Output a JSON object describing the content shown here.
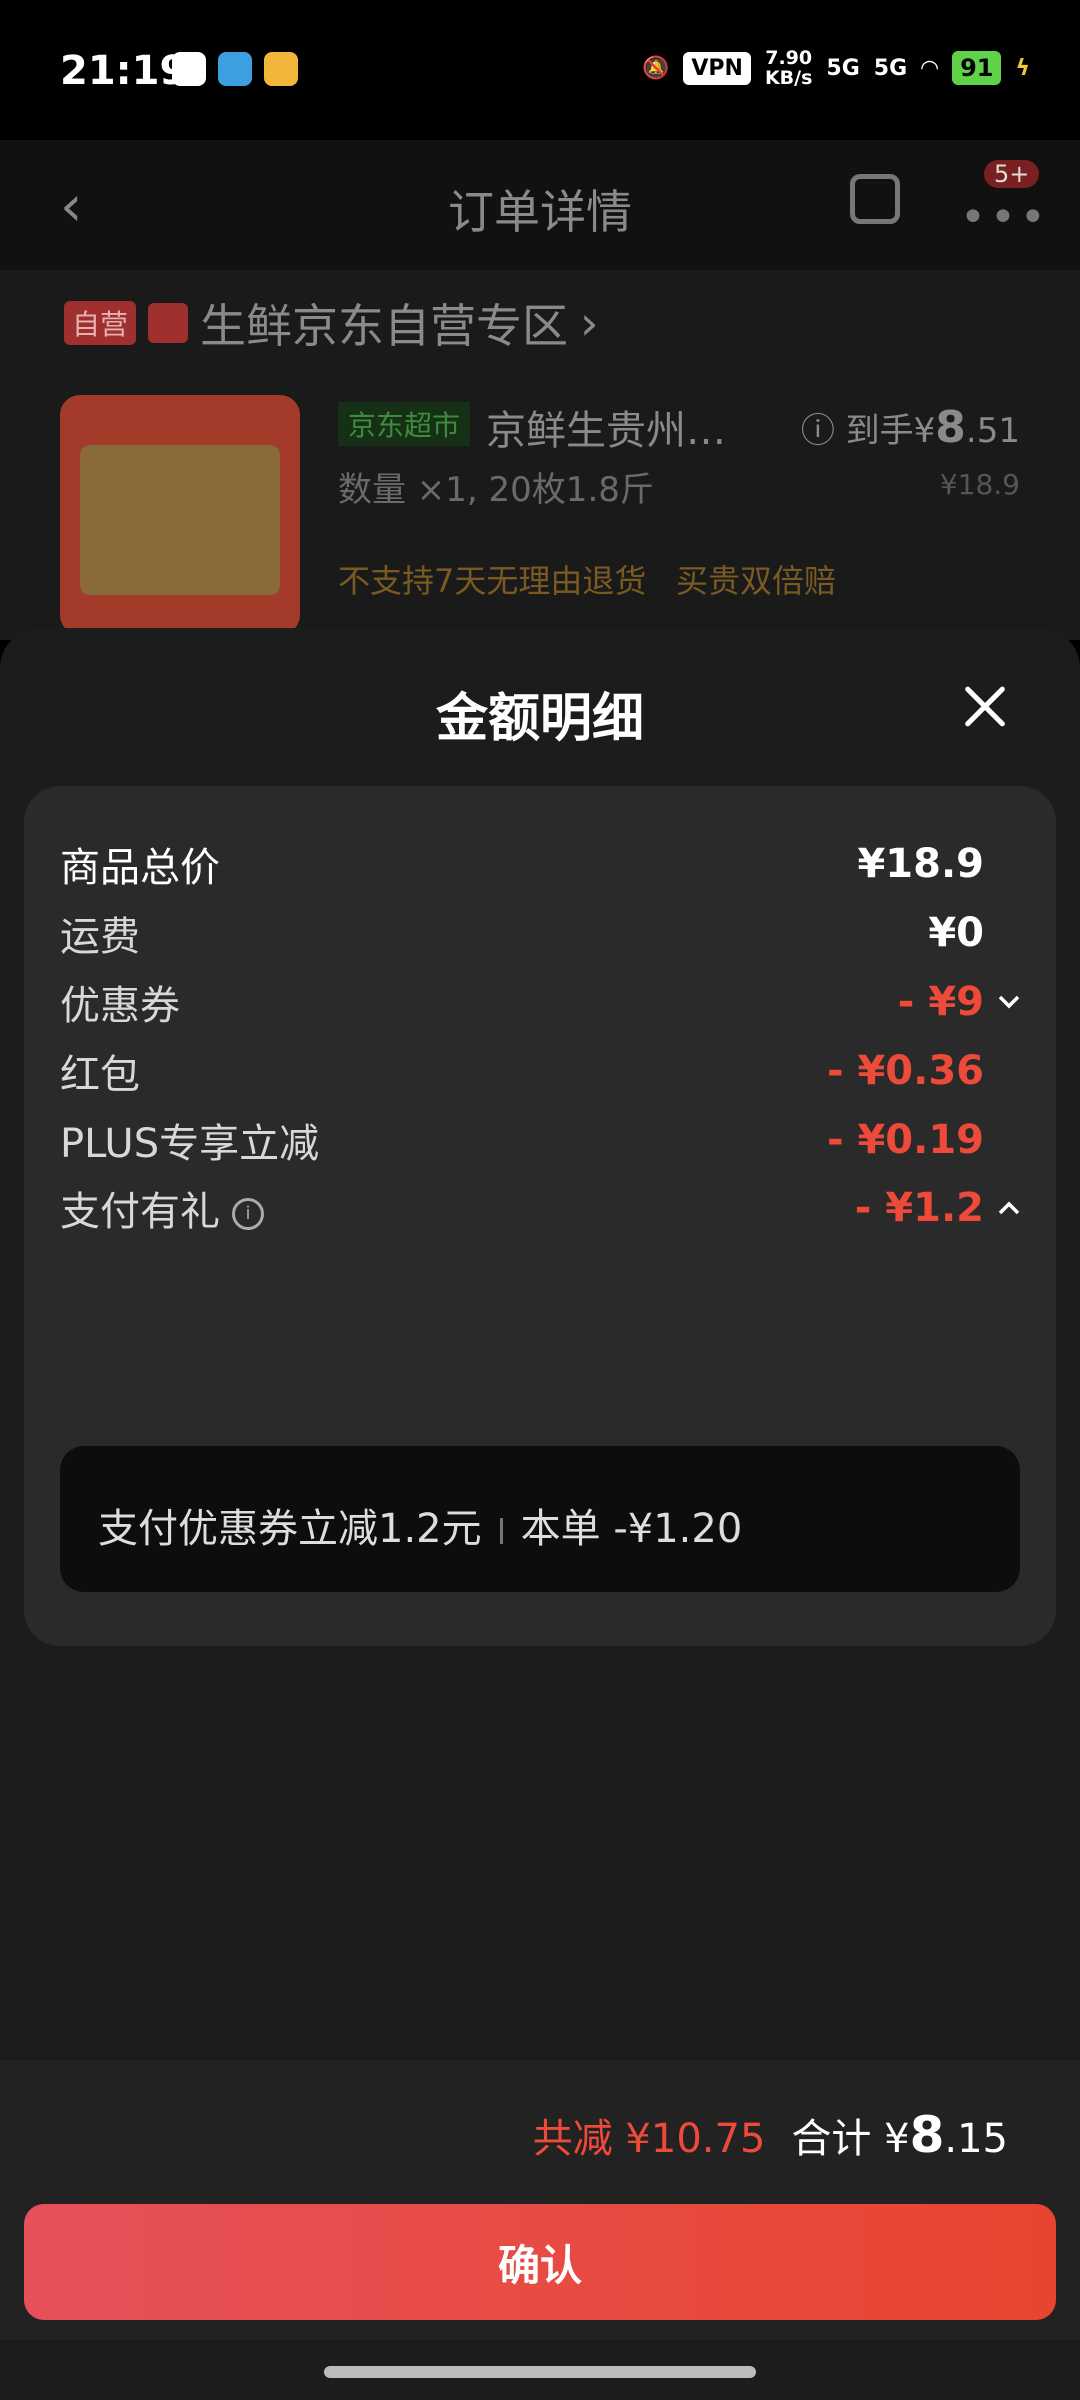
{
  "status_bar": {
    "time": "21:19",
    "vpn": "VPN",
    "speed_value": "7.90",
    "speed_unit": "KB/s",
    "network_1": "5G",
    "network_2": "5G",
    "battery": "91"
  },
  "background_page": {
    "nav_title": "订单详情",
    "more_badge": "5+",
    "self_operated_tag": "自营",
    "shop_name": "生鲜京东自营专区",
    "product_tag": "京东超市",
    "product_name": "京鲜生贵州…",
    "product_qty": "数量 ×1, 20枚1.8斤",
    "price_label": "到手¥",
    "price_main": "8",
    "price_decimal": ".51",
    "original_price": "¥18.9",
    "no_return_notice": "不支持7天无理由退货",
    "double_compensation": "买贵双倍赔"
  },
  "sheet": {
    "title": "金额明细",
    "rows": [
      {
        "label": "商品总价",
        "value": "¥18.9"
      },
      {
        "label": "运费",
        "value": "¥0"
      },
      {
        "label": "优惠券",
        "value": "- ¥9"
      },
      {
        "label": "红包",
        "value": "- ¥0.36"
      },
      {
        "label": "PLUS专享立减",
        "value": "- ¥0.19"
      },
      {
        "label": "支付有礼",
        "value": "- ¥1.2"
      }
    ],
    "pay_gift_detail": "支付优惠券立减1.2元",
    "pay_gift_order": "本单 -¥1.20"
  },
  "footer": {
    "saved": "共减 ¥10.75",
    "total_label": "合计 ¥",
    "total_main": "8",
    "total_decimal": ".15",
    "confirm_label": "确认"
  },
  "colors": {
    "accent_red": "#ee4a3a",
    "confirm_gradient_start": "#e6515a",
    "confirm_gradient_end": "#e8452f"
  }
}
